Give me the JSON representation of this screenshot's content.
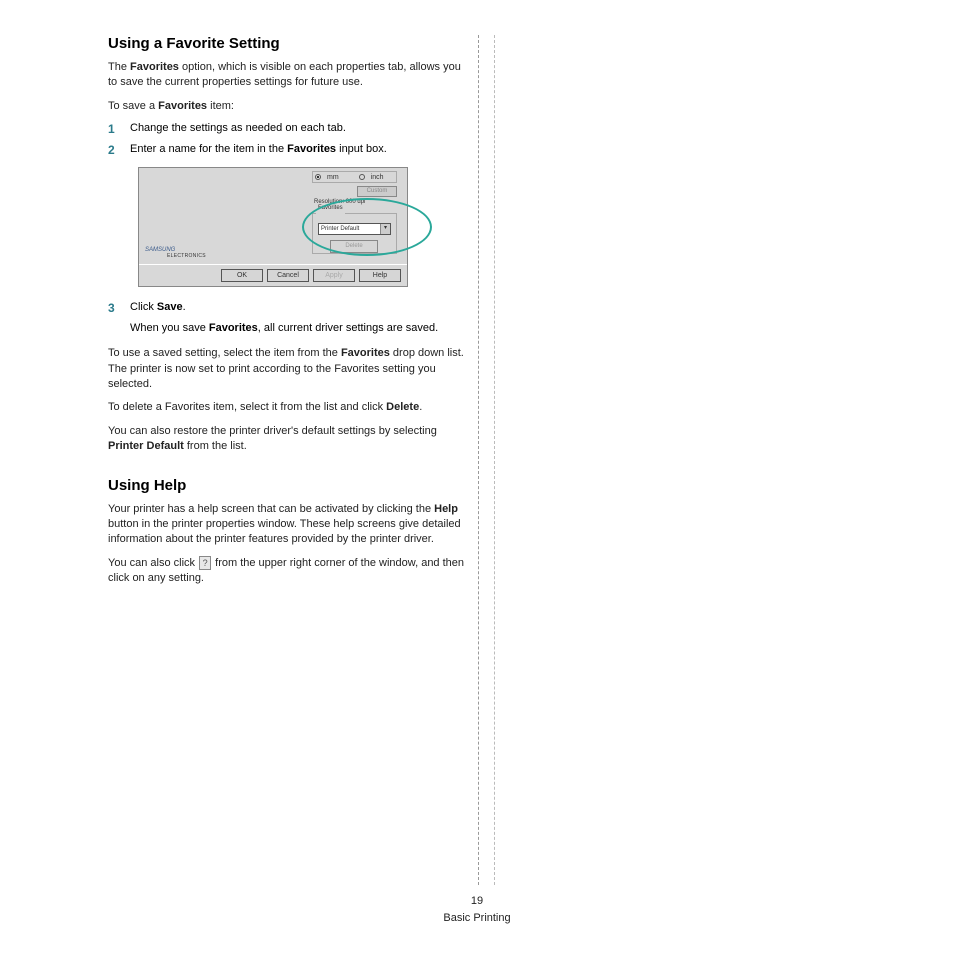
{
  "section1": {
    "title": "Using a Favorite Setting",
    "intro_pre": "The ",
    "intro_b1": "Favorites",
    "intro_post": " option, which is visible on each properties tab, allows you to save the current properties settings for future use.",
    "tosave_pre": "To save a ",
    "tosave_b": "Favorites",
    "tosave_post": " item:",
    "step1": "Change the settings as needed on each tab.",
    "step2_pre": "Enter a name for the item in the ",
    "step2_b": "Favorites",
    "step2_post": " input box.",
    "step3_pre": "Click ",
    "step3_b": "Save",
    "step3_post": ".",
    "step3_sub_pre": "When you save ",
    "step3_sub_b": "Favorites",
    "step3_sub_post": ", all current driver settings are saved.",
    "para_use_pre": "To use a saved setting, select the item from the ",
    "para_use_b": "Favorites",
    "para_use_post": " drop down list. The printer is now set to print according to the Favorites setting you selected.",
    "para_delete_pre": "To delete a Favorites item, select it from the list and click ",
    "para_delete_b": "Delete",
    "para_delete_post": ".",
    "para_restore_pre": "You can also restore the printer driver's default settings by selecting ",
    "para_restore_b": "Printer Default",
    "para_restore_post": " from the list."
  },
  "dialog": {
    "unit_mm": "mm",
    "unit_inch": "inch",
    "quality_btn": "Custom",
    "resolution": "Resolution: 600 dpi",
    "favorites_legend": "Favorites",
    "favorites_value": "Printer Default",
    "save_btn": "Delete",
    "logo": "SAMSUNG",
    "logo_sub": "ELECTRONICS",
    "ok": "OK",
    "cancel": "Cancel",
    "apply": "Apply",
    "help": "Help"
  },
  "section2": {
    "title": "Using Help",
    "para1_pre": "Your printer has a help screen that can be activated by clicking the ",
    "para1_b": "Help",
    "para1_post": " button in the printer properties window. These help screens give detailed information about the printer features provided by the printer driver.",
    "para2_pre": "You can also click ",
    "para2_post": " from the upper right corner of the window, and then click on any setting."
  },
  "footer": {
    "page": "19",
    "section": "Basic Printing"
  },
  "nums": {
    "n1": "1",
    "n2": "2",
    "n3": "3"
  },
  "icons": {
    "question": "?"
  }
}
